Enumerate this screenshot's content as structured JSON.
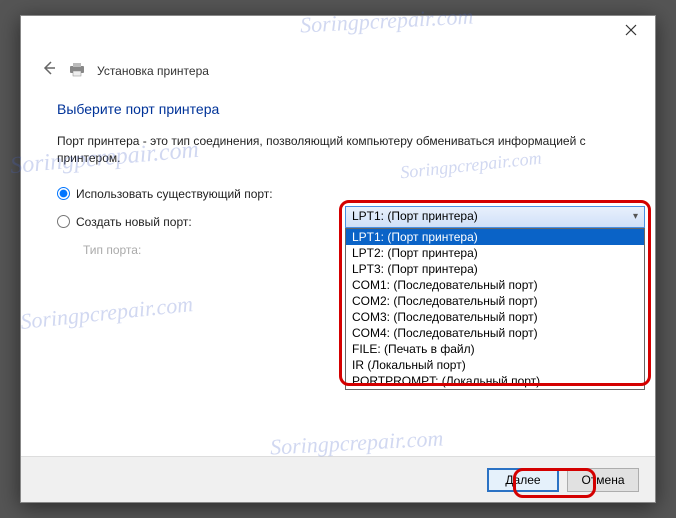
{
  "watermark": "Soringpcrepair.com",
  "header": {
    "title": "Установка принтера"
  },
  "content": {
    "heading": "Выберите порт принтера",
    "description": "Порт принтера - это тип соединения, позволяющий компьютеру обмениваться информацией с принтером.",
    "radio_existing": "Использовать существующий порт:",
    "radio_new": "Создать новый порт:",
    "port_type_label": "Тип порта:"
  },
  "combo": {
    "selected": "LPT1: (Порт принтера)",
    "options": [
      "LPT1: (Порт принтера)",
      "LPT2: (Порт принтера)",
      "LPT3: (Порт принтера)",
      "COM1: (Последовательный порт)",
      "COM2: (Последовательный порт)",
      "COM3: (Последовательный порт)",
      "COM4: (Последовательный порт)",
      "FILE: (Печать в файл)",
      "IR (Локальный порт)",
      "PORTPROMPT: (Локальный порт)"
    ]
  },
  "footer": {
    "next": "Далее",
    "cancel": "Отмена"
  }
}
